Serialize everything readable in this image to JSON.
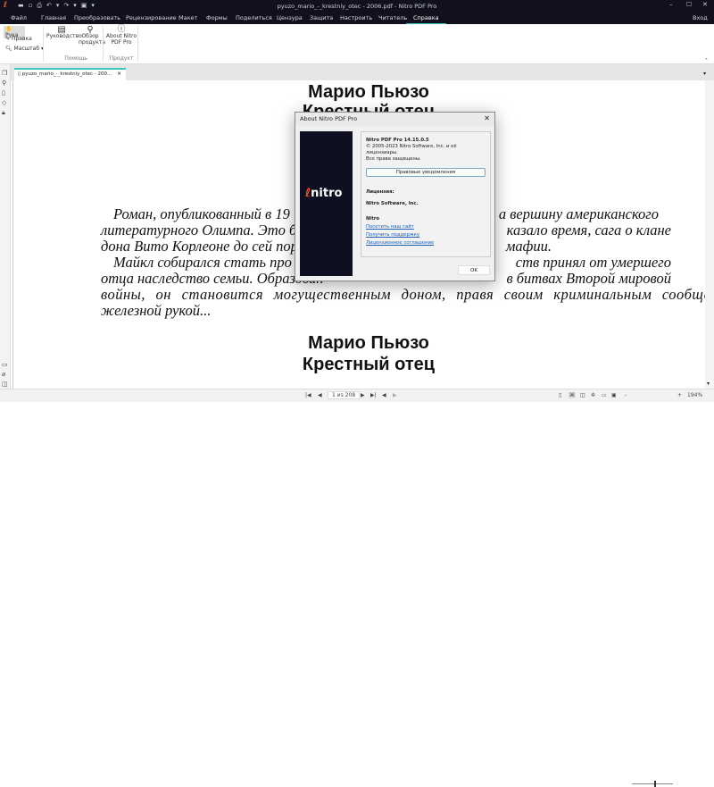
{
  "window": {
    "title": "pyuzo_mario_-_krestniy_otec - 2006.pdf - Nitro PDF Pro",
    "signin": "Вход"
  },
  "menu": [
    "Файл",
    "Главная",
    "Преобразовать",
    "Рецензирование",
    "Макет",
    "Формы",
    "Поделиться",
    "Цензура",
    "Защита",
    "Настроить",
    "Читатель",
    "Справка"
  ],
  "ribbon": {
    "hand": "Рука",
    "edit": "Правка",
    "zoom": "Масштаб",
    "guide": "Руководство",
    "overview": "Обзор продукта",
    "help_group": "Помощь",
    "about": "About Nitro PDF Pro",
    "product_group": "Продукт"
  },
  "tab": {
    "label": "pyuzo_mario_-_krestniy_otec - 200..."
  },
  "document": {
    "heading1": "Марио Пьюзо",
    "heading2": "Крестный отец",
    "lines": [
      [
        "Роман, опубликованный в 19",
        "а вершину американского"
      ],
      [
        "литературного Олимпа. Это был",
        "казало время, сага о клане"
      ],
      [
        "дона Вито Корлеоне до сей поры ос",
        "мафии."
      ],
      [
        "Майкл собирался стать про",
        "ств принял от умершего"
      ],
      [
        "отца наследство семьи. Образован",
        "в битвах Второй мировой"
      ],
      [
        "войны, он становится могущественным доном, правя своим криминальным сообществом",
        ""
      ],
      [
        "железной рукой...",
        ""
      ]
    ],
    "heading3": "Марио Пьюзо",
    "heading4": "Крестный отец"
  },
  "status": {
    "page": "1 из 208",
    "zoom": "194%"
  },
  "dialog": {
    "title": "About Nitro PDF Pro",
    "logo": "nitro",
    "product": "Nitro PDF Pro 14.15.0.5",
    "copyright": "© 2005-2023 Nitro Software, Inc. и её лицензиары.",
    "rights": "Все права защищены.",
    "legal_button": "Правовые уведомления",
    "license_label": "Лицензия:",
    "licensee": "Nitro Software, Inc.",
    "nitro": "Nitro",
    "links": [
      "Посетить наш сайт",
      "Получить поддержку",
      "Лицензионное соглашение"
    ],
    "ok": "OK"
  }
}
